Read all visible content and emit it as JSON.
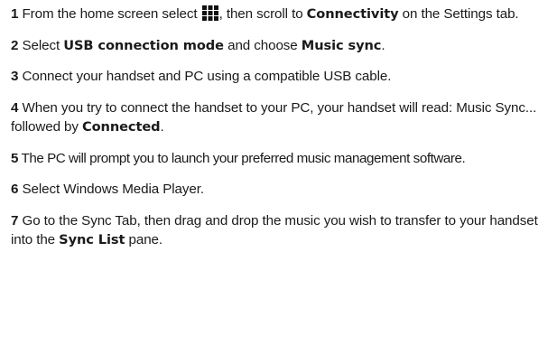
{
  "steps": [
    {
      "num": "1",
      "t1": "From the home screen select",
      "icon": "apps-grid-icon",
      "t2": ", then scroll to",
      "b1": "Connectivity",
      "t3": "on the Settings tab."
    },
    {
      "num": "2",
      "t1": "Select",
      "b1": "USB connection mode",
      "t2": "and choose",
      "b2": "Music sync",
      "t3": "."
    },
    {
      "num": "3",
      "t1": "Connect your handset and PC using a compatible USB cable."
    },
    {
      "num": "4",
      "t1": "When you try to connect the handset to your PC, your handset will read: Music Sync... followed by",
      "b1": "Connected",
      "t2": "."
    },
    {
      "num": "5",
      "t1": "The PC will prompt you to launch your preferred music management software."
    },
    {
      "num": "6",
      "t1": "Select Windows Media Player."
    },
    {
      "num": "7",
      "t1": "Go to the Sync Tab, then drag and drop the music you wish to transfer to your handset into the",
      "b1": "Sync List",
      "t2": "pane."
    }
  ]
}
